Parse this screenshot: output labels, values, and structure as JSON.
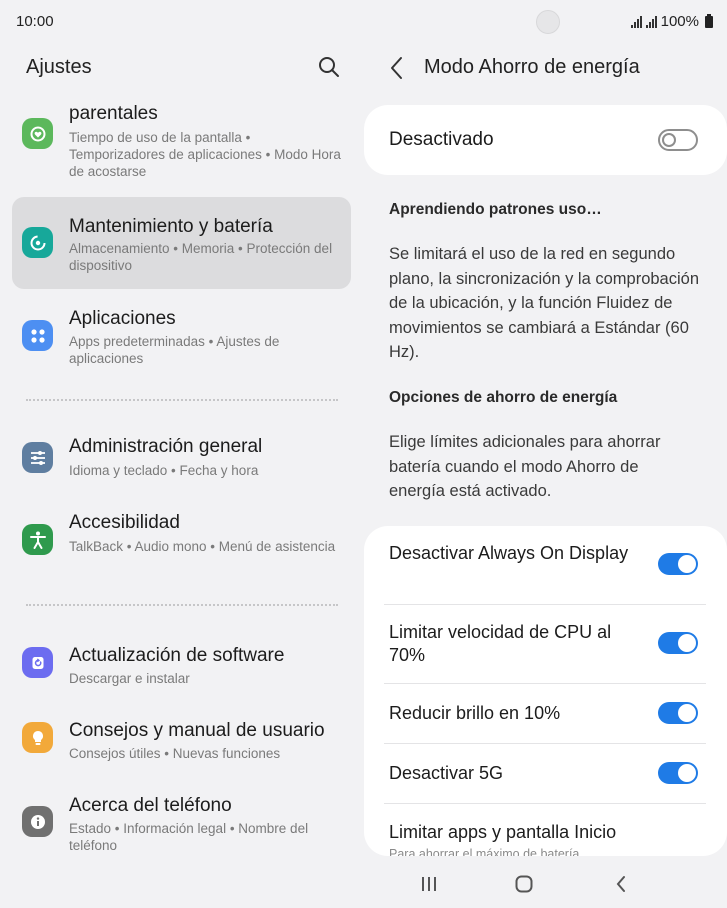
{
  "status_bar": {
    "time": "10:00",
    "battery": "100%"
  },
  "left_pane": {
    "title": "Ajustes",
    "items": [
      {
        "title": "parentales",
        "subtitle": "Tiempo de uso de la pantalla  •  Temporizadores de aplicaciones  •  Modo Hora de acostarse",
        "icon": "digital-wellbeing-icon",
        "color": "#5cb85c"
      },
      {
        "title": "Mantenimiento y batería",
        "subtitle": "Almacenamiento  •  Memoria  •  Protección del dispositivo",
        "icon": "device-care-icon",
        "color": "#17a89a"
      },
      {
        "title": "Aplicaciones",
        "subtitle": "Apps predeterminadas  •  Ajustes de aplicaciones",
        "icon": "apps-icon",
        "color": "#4d8ff2"
      },
      {
        "title": "Administración general",
        "subtitle": "Idioma y teclado  •  Fecha y hora",
        "icon": "sliders-icon",
        "color": "#5f7ea0"
      },
      {
        "title": "Accesibilidad",
        "subtitle": "TalkBack  •  Audio mono  •  Menú de asistencia",
        "icon": "accessibility-icon",
        "color": "#2f9a4d"
      },
      {
        "title": "Actualización de software",
        "subtitle": "Descargar e instalar",
        "icon": "software-update-icon",
        "color": "#6c6cf0"
      },
      {
        "title": "Consejos y manual de usuario",
        "subtitle": "Consejos útiles  •  Nuevas funciones",
        "icon": "tips-icon",
        "color": "#f2a93a"
      },
      {
        "title": "Acerca del teléfono",
        "subtitle": "Estado  •  Información legal  •  Nombre del teléfono",
        "icon": "info-icon",
        "color": "#707070"
      }
    ]
  },
  "right_pane": {
    "title": "Modo Ahorro de energía",
    "main_toggle": {
      "label": "Desactivado",
      "state": "off"
    },
    "learning": {
      "heading": "Aprendiendo patrones uso…",
      "text": "Se limitará el uso de la red en segundo plano, la sincronización y la comprobación de la ubicación, y la función Fluidez de movimientos se cambiará a Estándar (60 Hz)."
    },
    "options_section": {
      "heading": "Opciones de ahorro de energía",
      "text": "Elige límites adicionales para ahorrar batería cuando el modo Ahorro de energía está activado."
    },
    "options": [
      {
        "label": "Desactivar Always On Display",
        "state": "on"
      },
      {
        "label": "Limitar velocidad de CPU al 70%",
        "state": "on"
      },
      {
        "label": "Reducir brillo en 10%",
        "state": "on"
      },
      {
        "label": "Desactivar 5G",
        "state": "on"
      },
      {
        "label": "Limitar apps y pantalla Inicio",
        "hint": "Para ahorrar el máximo de batería"
      }
    ],
    "accent_color": "#1f7be6"
  }
}
